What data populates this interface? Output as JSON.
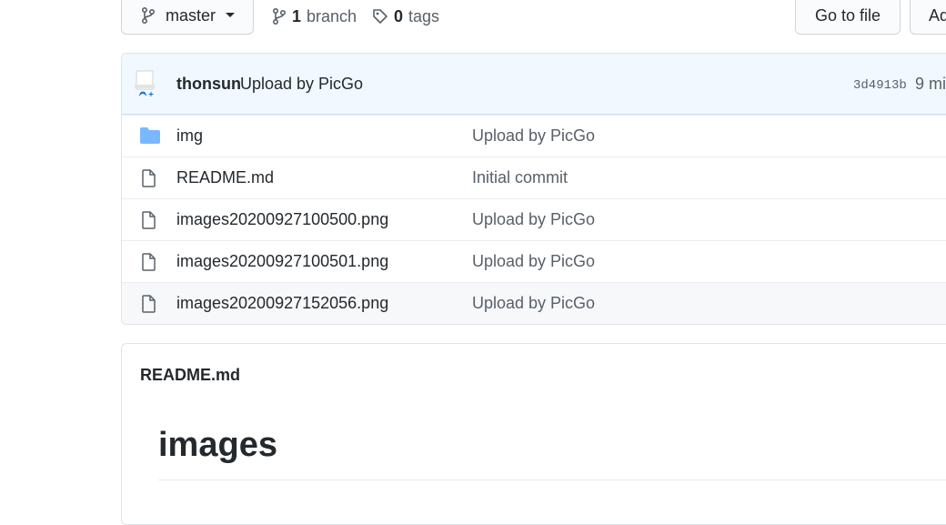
{
  "toolbar": {
    "branch_name": "master",
    "branch_count": "1",
    "branch_label": "branch",
    "tag_count": "0",
    "tag_label": "tags",
    "go_to_file_label": "Go to file",
    "add_file_label": "Ad"
  },
  "latest_commit": {
    "author": "thonsun",
    "message": "Upload by PicGo",
    "sha": "3d4913b",
    "time": "9 mi"
  },
  "files": [
    {
      "type": "folder",
      "name": "img",
      "commit": "Upload by PicGo"
    },
    {
      "type": "file",
      "name": "README.md",
      "commit": "Initial commit"
    },
    {
      "type": "file",
      "name": "images20200927100500.png",
      "commit": "Upload by PicGo"
    },
    {
      "type": "file",
      "name": "images20200927100501.png",
      "commit": "Upload by PicGo"
    },
    {
      "type": "file",
      "name": "images20200927152056.png",
      "commit": "Upload by PicGo"
    }
  ],
  "readme": {
    "filename": "README.md",
    "heading": "images"
  },
  "colors": {
    "folder_icon": "#79b8ff",
    "commit_bar_bg": "#f1f8ff",
    "muted_text": "#586069"
  }
}
